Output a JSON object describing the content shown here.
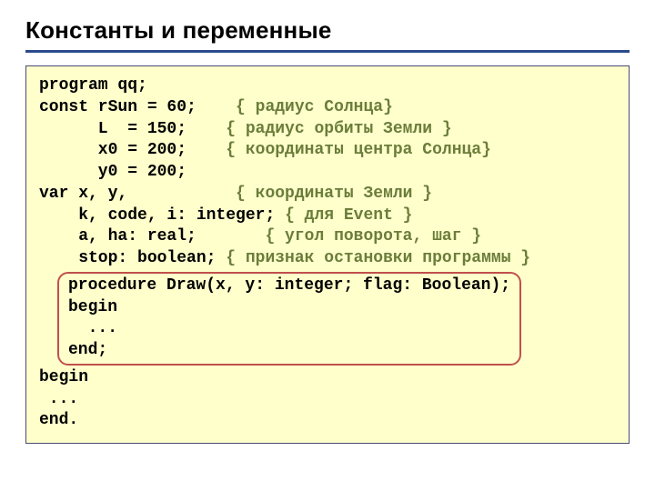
{
  "title": "Константы и переменные",
  "code": {
    "l1": "program qq;",
    "l2a": "const rSun = 60;",
    "l2b": "{ радиус Солнца}",
    "l3a": "      L  = 150;",
    "l3b": "{ радиус орбиты Земли }",
    "l4a": "      x0 = 200;",
    "l4b": "{ координаты центра Солнца}",
    "l5": "      y0 = 200;",
    "l6a": "var x, y,",
    "l6b": "{ координаты Земли }",
    "l7a": "    k, code, i: integer;",
    "l7b": "{ для Event }",
    "l8a": "    a, ha: real;",
    "l8b": "{ угол поворота, шаг }",
    "l9a": "    stop: boolean;",
    "l9b": "{ признак остановки программы }",
    "p1": "procedure Draw(x, y: integer; flag: Boolean);",
    "p2": "begin",
    "p3": "  ...",
    "p4": "end;",
    "l10": "begin",
    "l11": " ...",
    "l12": "end."
  }
}
